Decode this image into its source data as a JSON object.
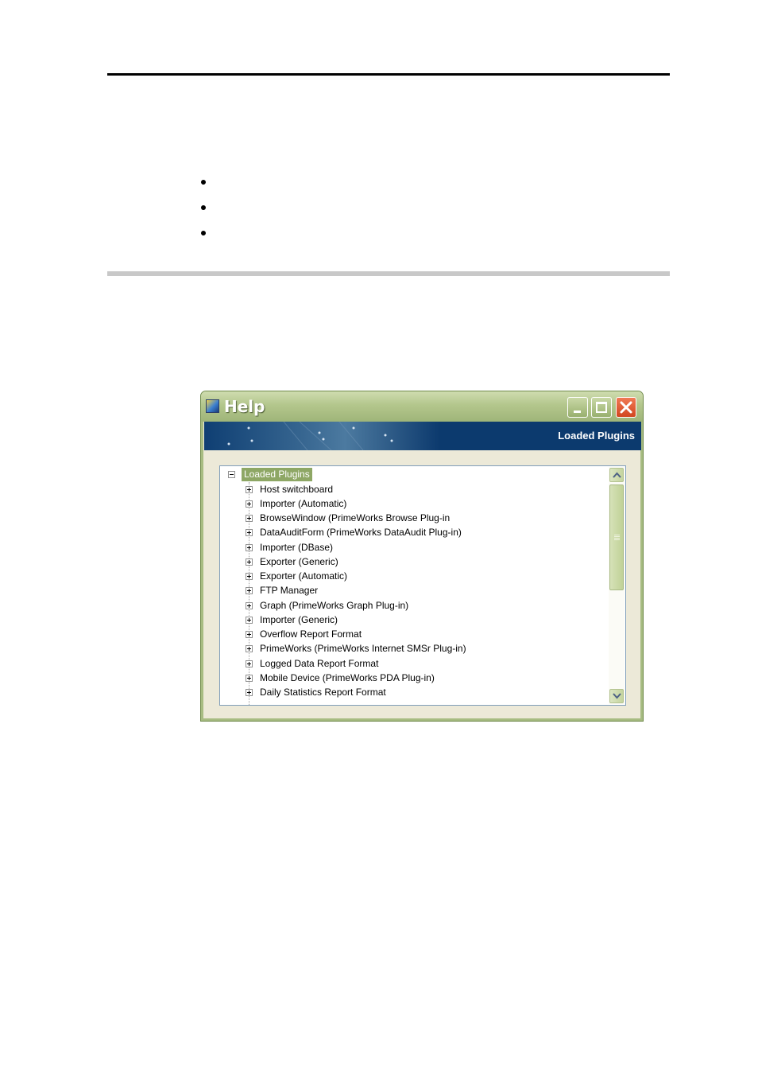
{
  "document": {
    "bullets": [
      "",
      "",
      ""
    ]
  },
  "window": {
    "title": "Help",
    "banner_title": "Loaded Plugins",
    "tree": {
      "root_label": "Loaded Plugins",
      "items": [
        "Host switchboard",
        "Importer (Automatic)",
        "BrowseWindow (PrimeWorks Browse Plug-in",
        "DataAuditForm (PrimeWorks DataAudit Plug-in)",
        "Importer (DBase)",
        "Exporter (Generic)",
        "Exporter (Automatic)",
        "FTP Manager",
        "Graph (PrimeWorks Graph Plug-in)",
        "Importer (Generic)",
        "Overflow Report Format",
        "PrimeWorks (PrimeWorks Internet SMSr Plug-in)",
        "Logged Data Report Format",
        "Mobile Device (PrimeWorks PDA Plug-in)",
        "Daily Statistics Report Format"
      ]
    }
  },
  "colors": {
    "titlebar": "#b3c68c",
    "banner": "#0c3a6e",
    "selected_root": "#8ea765"
  },
  "icons": [
    "app-icon",
    "minimize-icon",
    "maximize-icon",
    "close-icon",
    "collapse-icon",
    "expand-icon",
    "scroll-up-icon",
    "scroll-down-icon"
  ]
}
